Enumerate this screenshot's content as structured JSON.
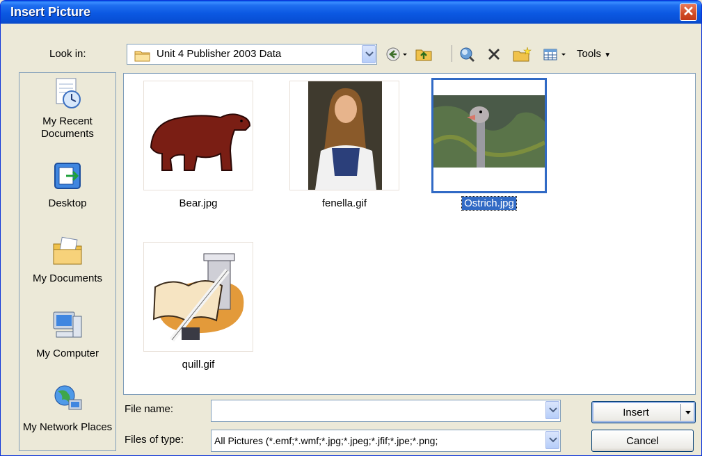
{
  "window": {
    "title": "Insert Picture"
  },
  "toolbar": {
    "look_in_label": "Look in:",
    "look_in_value": "Unit 4 Publisher 2003 Data",
    "tools_label": "Tools"
  },
  "places": [
    {
      "label": "My Recent Documents"
    },
    {
      "label": "Desktop"
    },
    {
      "label": "My Documents"
    },
    {
      "label": "My Computer"
    },
    {
      "label": "My Network Places"
    }
  ],
  "files": [
    {
      "name": "Bear.jpg",
      "selected": false
    },
    {
      "name": "fenella.gif",
      "selected": false
    },
    {
      "name": "Ostrich.jpg",
      "selected": true
    },
    {
      "name": "quill.gif",
      "selected": false
    }
  ],
  "form": {
    "file_name_label": "File name:",
    "file_name_value": "",
    "file_type_label": "Files of type:",
    "file_type_value": "All Pictures (*.emf;*.wmf;*.jpg;*.jpeg;*.jfif;*.jpe;*.png;"
  },
  "buttons": {
    "insert": "Insert",
    "cancel": "Cancel"
  },
  "colors": {
    "title_bar": "#0a58e0",
    "selection": "#316ac5",
    "dialog_bg": "#ece9d8"
  }
}
